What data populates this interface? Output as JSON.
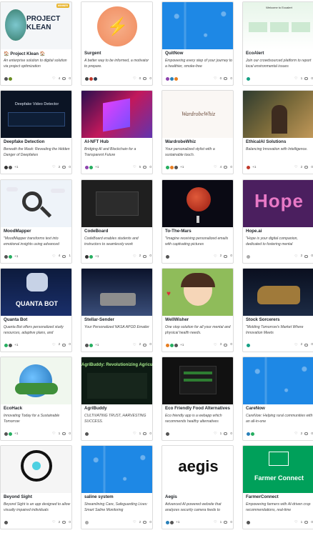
{
  "cards": [
    {
      "title": "🏠 Project Klean 🏠",
      "desc": "An enterprise solution to digital solution via project optimization",
      "avs": [
        "#555",
        "#6b8e23"
      ],
      "plus": "",
      "s1": "4",
      "s2": "0",
      "winner": "WINNER",
      "thumb": "klean",
      "thumb_text": "PROJECT KLEAN"
    },
    {
      "title": "Surgent",
      "desc": "A better way to be informed, a motivator to prepare.",
      "avs": [
        "#444",
        "#c0392b",
        "#2c3e50"
      ],
      "plus": "",
      "s1": "0",
      "s2": "0",
      "thumb": "surgent"
    },
    {
      "title": "QuitNow",
      "desc": "Empowering every step of your journey to a healthier, smoke-free",
      "avs": [
        "#8e44ad",
        "#2980b9",
        "#e67e22"
      ],
      "plus": "",
      "s1": "0",
      "s2": "0",
      "thumb": "blue"
    },
    {
      "title": "EcoAlert",
      "desc": "Join our crowdsourced platform to report local environmental issues",
      "avs": [
        "#16a085"
      ],
      "plus": "",
      "s1": "1",
      "s2": "0",
      "thumb": "ecoalert",
      "thumb_text": "Welcome to Ecoalert"
    },
    {
      "title": "Deepfake Detection",
      "desc": "Beneath the Mask: Revealing the Hidden Danger of Deepfakes",
      "avs": [
        "#333",
        "#555"
      ],
      "plus": "+1",
      "s1": "2",
      "s2": "0",
      "thumb": "deepfake",
      "thumb_text": "Deepfake Video Detector"
    },
    {
      "title": "AI-NFT Hub",
      "desc": "Bridging AI and Blockchain for a Transparent Future",
      "avs": [
        "#8e44ad",
        "#27ae60"
      ],
      "plus": "+1",
      "s1": "5",
      "s2": "0",
      "thumb": "nft"
    },
    {
      "title": "WardrobeWhiz",
      "desc": "Your personalized stylist with a sustainable touch.",
      "avs": [
        "#27ae60",
        "#e67e22",
        "#555"
      ],
      "plus": "+1",
      "s1": "4",
      "s2": "0",
      "thumb": "wardrobe",
      "thumb_text": "WardrobeWhiz"
    },
    {
      "title": "EthicalAI Solutions",
      "desc": "Balancing Innovation with Intelligence.",
      "avs": [
        "#c0392b"
      ],
      "plus": "+1",
      "s1": "2",
      "s2": "0",
      "thumb": "ethical"
    },
    {
      "title": "MoodMapper",
      "desc": "\"MoodMapper transforms text into emotional insights using advanced",
      "avs": [
        "#555",
        "#27ae60"
      ],
      "plus": "+1",
      "s1": "4",
      "s2": "1",
      "thumb": "mood"
    },
    {
      "title": "CodeBoard",
      "desc": "CodeBoard enables students and instructors to seamlessly work",
      "avs": [
        "#333",
        "#27ae60"
      ],
      "plus": "+1",
      "s1": "2",
      "s2": "0",
      "thumb": "codeboard"
    },
    {
      "title": "To-The-Mars",
      "desc": "\"Imagine receiving personalized emails with captivating pictures",
      "avs": [
        "#555"
      ],
      "plus": "",
      "s1": "2",
      "s2": "0",
      "thumb": "mars"
    },
    {
      "title": "Hope.ai",
      "desc": "\"Hope is your digital companion, dedicated to fostering mental",
      "avs": [
        "#aaa"
      ],
      "plus": "",
      "s1": "2",
      "s2": "0",
      "thumb": "hope",
      "thumb_text": "Hope"
    },
    {
      "title": "Quanta Bot",
      "desc": "Quanta Bot offers personalized study resources, adaptive plans, and",
      "avs": [
        "#27ae60",
        "#555"
      ],
      "plus": "+1",
      "s1": "2",
      "s2": "0",
      "thumb": "quanta",
      "thumb_text": "QUANTA BOT"
    },
    {
      "title": "Stellar-Sender",
      "desc": "Your Personalized NASA APOD Emailer",
      "avs": [
        "#555",
        "#27ae60"
      ],
      "plus": "+1",
      "s1": "2",
      "s2": "0",
      "thumb": "stellar"
    },
    {
      "title": "WellWisher",
      "desc": "One stop solution for all your mental and physical health needs.",
      "avs": [
        "#e67e22",
        "#27ae60",
        "#555"
      ],
      "plus": "+1",
      "s1": "3",
      "s2": "0",
      "thumb": "well"
    },
    {
      "title": "Stock Sorcerers",
      "desc": "\"Molding Tomorrow's Market Where Innovation Meets",
      "avs": [
        "#16a085"
      ],
      "plus": "",
      "s1": "2",
      "s2": "0",
      "thumb": "stock"
    },
    {
      "title": "EcoHack",
      "desc": "Innovating Today for a Sustainable Tomorrow",
      "avs": [
        "#555",
        "#27ae60"
      ],
      "plus": "+1",
      "s1": "1",
      "s2": "0",
      "thumb": "ecohack"
    },
    {
      "title": "AgriBuddy",
      "desc": "CULTIVATING TRUST, HARVESTING SUCCESS.",
      "avs": [
        "#555"
      ],
      "plus": "",
      "s1": "1",
      "s2": "0",
      "thumb": "agri",
      "thumb_text": "AgriBuddy: Revolutionizing Agricult"
    },
    {
      "title": "Eco Friendly Food Alternatives",
      "desc": "Eco friendly app is a webapp which recommends healthy alternatives",
      "avs": [
        "#555"
      ],
      "plus": "",
      "s1": "1",
      "s2": "0",
      "thumb": "ecofood"
    },
    {
      "title": "CareNow",
      "desc": "CareNow: Helping rural communities with an all-in-one",
      "avs": [
        "#2980b9",
        "#27ae60"
      ],
      "plus": "",
      "s1": "2",
      "s2": "0",
      "thumb": "blue"
    },
    {
      "title": "Beyond Sight",
      "desc": "Beyond Sight is an app designed to allow visually impaired individuals",
      "avs": [
        "#555"
      ],
      "plus": "",
      "s1": "2",
      "s2": "0",
      "thumb": "beyond"
    },
    {
      "title": "saline system",
      "desc": "Streamlining Care, Safeguarding Lives: Smart Saline Monitoring",
      "avs": [
        "#aaa"
      ],
      "plus": "",
      "s1": "2",
      "s2": "0",
      "thumb": "blue"
    },
    {
      "title": "Aegis",
      "desc": "Advanced AI-powered website that analyzes security camera feeds to",
      "avs": [
        "#2980b9",
        "#555"
      ],
      "plus": "+1",
      "s1": "1",
      "s2": "0",
      "thumb": "aegis",
      "thumb_text": "aegis"
    },
    {
      "title": "FarmerConnect",
      "desc": "Empowering farmers with AI-driven crop recommendations, real-time",
      "avs": [
        "#555"
      ],
      "plus": "",
      "s1": "1",
      "s2": "0",
      "thumb": "farmer",
      "thumb_text": "Farmer Connect"
    }
  ]
}
